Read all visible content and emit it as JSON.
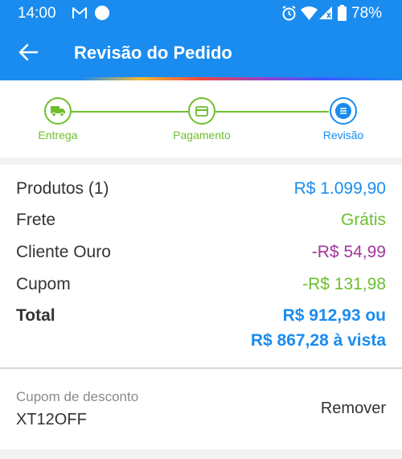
{
  "status_bar": {
    "time": "14:00",
    "battery_percent": "78%",
    "icons": [
      "mail-icon",
      "notification-dot-icon",
      "alarm-icon",
      "wifi-icon",
      "signal-icon",
      "battery-icon"
    ]
  },
  "app_bar": {
    "title": "Revisão do Pedido",
    "back_icon": "arrow-left-icon"
  },
  "stepper": {
    "steps": [
      {
        "label": "Entrega",
        "icon": "truck-icon",
        "state": "completed"
      },
      {
        "label": "Pagamento",
        "icon": "card-icon",
        "state": "completed"
      },
      {
        "label": "Revisão",
        "icon": "document-icon",
        "state": "current"
      }
    ]
  },
  "summary": {
    "rows": [
      {
        "label": "Produtos (1)",
        "value": "R$ 1.099,90"
      },
      {
        "label": "Frete",
        "value": "Grátis"
      },
      {
        "label": "Cliente Ouro",
        "value": "-R$ 54,99"
      },
      {
        "label": "Cupom",
        "value": "-R$ 131,98"
      }
    ],
    "total": {
      "label": "Total",
      "value_line1": "R$ 912,93 ou",
      "value_line2": "R$ 867,28 à vista"
    }
  },
  "coupon": {
    "label": "Cupom de desconto",
    "code": "XT12OFF",
    "remove_label": "Remover"
  },
  "colors": {
    "primary_blue": "#1a8cf0",
    "green": "#6dbf2e",
    "purple": "#a3369b",
    "text": "#333333"
  }
}
